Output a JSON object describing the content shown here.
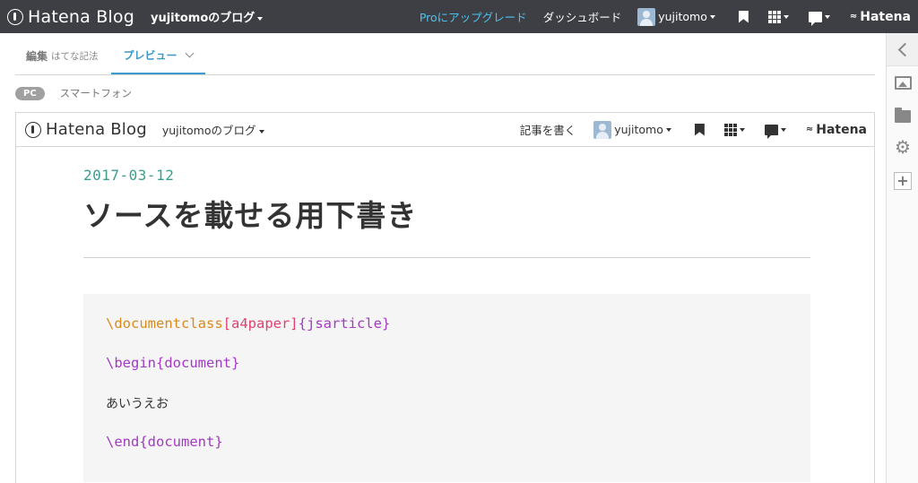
{
  "topbar": {
    "logo_text": "Hatena Blog",
    "blog_name": "yujitomoのブログ",
    "pro_upgrade": "Proにアップグレード",
    "dashboard": "ダッシュボード",
    "user_name": "yujitomo",
    "brand": "Hatena",
    "accent_color": "#4fc2ef",
    "icons": [
      "bookmark-icon",
      "apps-grid-icon",
      "comment-icon",
      "hatena-logo-icon"
    ]
  },
  "editor_tabs": {
    "edit_label": "編集",
    "edit_mode": "はてな記法",
    "preview_label": "プレビュー"
  },
  "device_switch": {
    "pc": "PC",
    "smartphone": "スマートフォン"
  },
  "preview": {
    "header": {
      "logo_text": "Hatena Blog",
      "blog_name": "yujitomoのブログ",
      "write_article": "記事を書く",
      "user_name": "yujitomo",
      "brand": "Hatena"
    },
    "article": {
      "date": "2017-03-12",
      "title": "ソースを載せる用下書き",
      "code": {
        "line1": {
          "cmd": "\\documentclass",
          "opt": "[a4paper]",
          "arg": "{jsarticle}"
        },
        "line2": "\\begin{document}",
        "line3": "あいうえお",
        "line4": "\\end{document}"
      }
    }
  },
  "rail": {
    "items": [
      "chevron-left-icon",
      "image-icon",
      "folder-icon",
      "gear-icon",
      "plus-icon"
    ],
    "gear_glyph": "⚙",
    "plus_glyph": "+"
  }
}
